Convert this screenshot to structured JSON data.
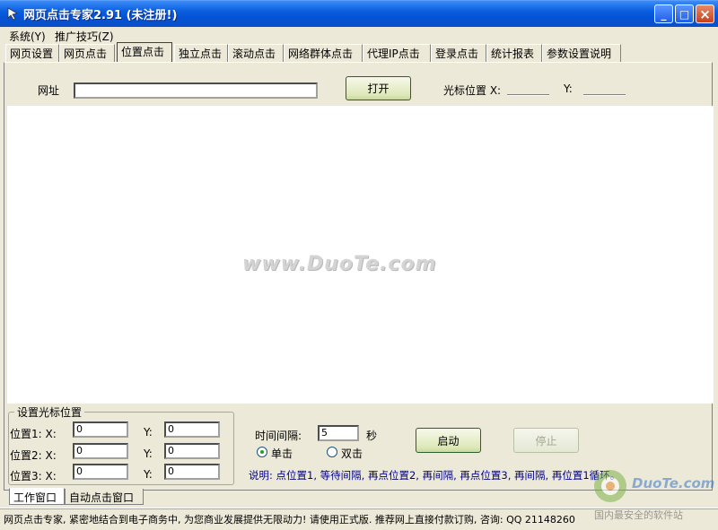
{
  "window": {
    "title": "网页点击专家2.91 (未注册!)",
    "minimize": "_",
    "maximize": "□",
    "close": "×"
  },
  "menu": {
    "system": "系统(Y)",
    "promo": "推广技巧(Z)"
  },
  "tabs": [
    {
      "label": "网页设置"
    },
    {
      "label": "网页点击"
    },
    {
      "label": "位置点击"
    },
    {
      "label": "独立点击"
    },
    {
      "label": "滚动点击"
    },
    {
      "label": "网络群体点击"
    },
    {
      "label": "代理IP点击"
    },
    {
      "label": "登录点击"
    },
    {
      "label": "统计报表"
    },
    {
      "label": "参数设置说明"
    }
  ],
  "top": {
    "url_label": "网址",
    "url_value": "",
    "open_button": "打开",
    "cursor_label": "光标位置 X:",
    "y_label": "Y:",
    "x_value": "",
    "y_value": ""
  },
  "watermark": "www.DuoTe.com",
  "group": {
    "title": "设置光标位置",
    "rows": [
      {
        "label": "位置1: X:",
        "x": "0",
        "ylabel": "Y:",
        "y": "0"
      },
      {
        "label": "位置2: X:",
        "x": "0",
        "ylabel": "Y:",
        "y": "0"
      },
      {
        "label": "位置3: X:",
        "x": "0",
        "ylabel": "Y:",
        "y": "0"
      }
    ]
  },
  "timing": {
    "label": "时间间隔:",
    "value": "5",
    "unit": "秒",
    "single": "单击",
    "double": "双击",
    "start": "启动",
    "stop": "停止"
  },
  "explain": "说明: 点位置1, 等待间隔, 再点位置2, 再间隔, 再点位置3, 再间隔, 再位置1循环。",
  "bottom_tabs": {
    "work": "工作窗口",
    "auto": "自动点击窗口"
  },
  "status": "网页点击专家, 紧密地结合到电子商务中, 为您商业发展提供无限动力! 请使用正式版. 推荐网上直接付款订购, 咨询: QQ 21148260",
  "corner_watermark": {
    "brand": "DuoTe.com",
    "slogan": "国内最安全的软件站"
  },
  "colors": {
    "titlebar": "#0553d6",
    "face": "#ece9d8",
    "explain_text": "#00008b"
  }
}
